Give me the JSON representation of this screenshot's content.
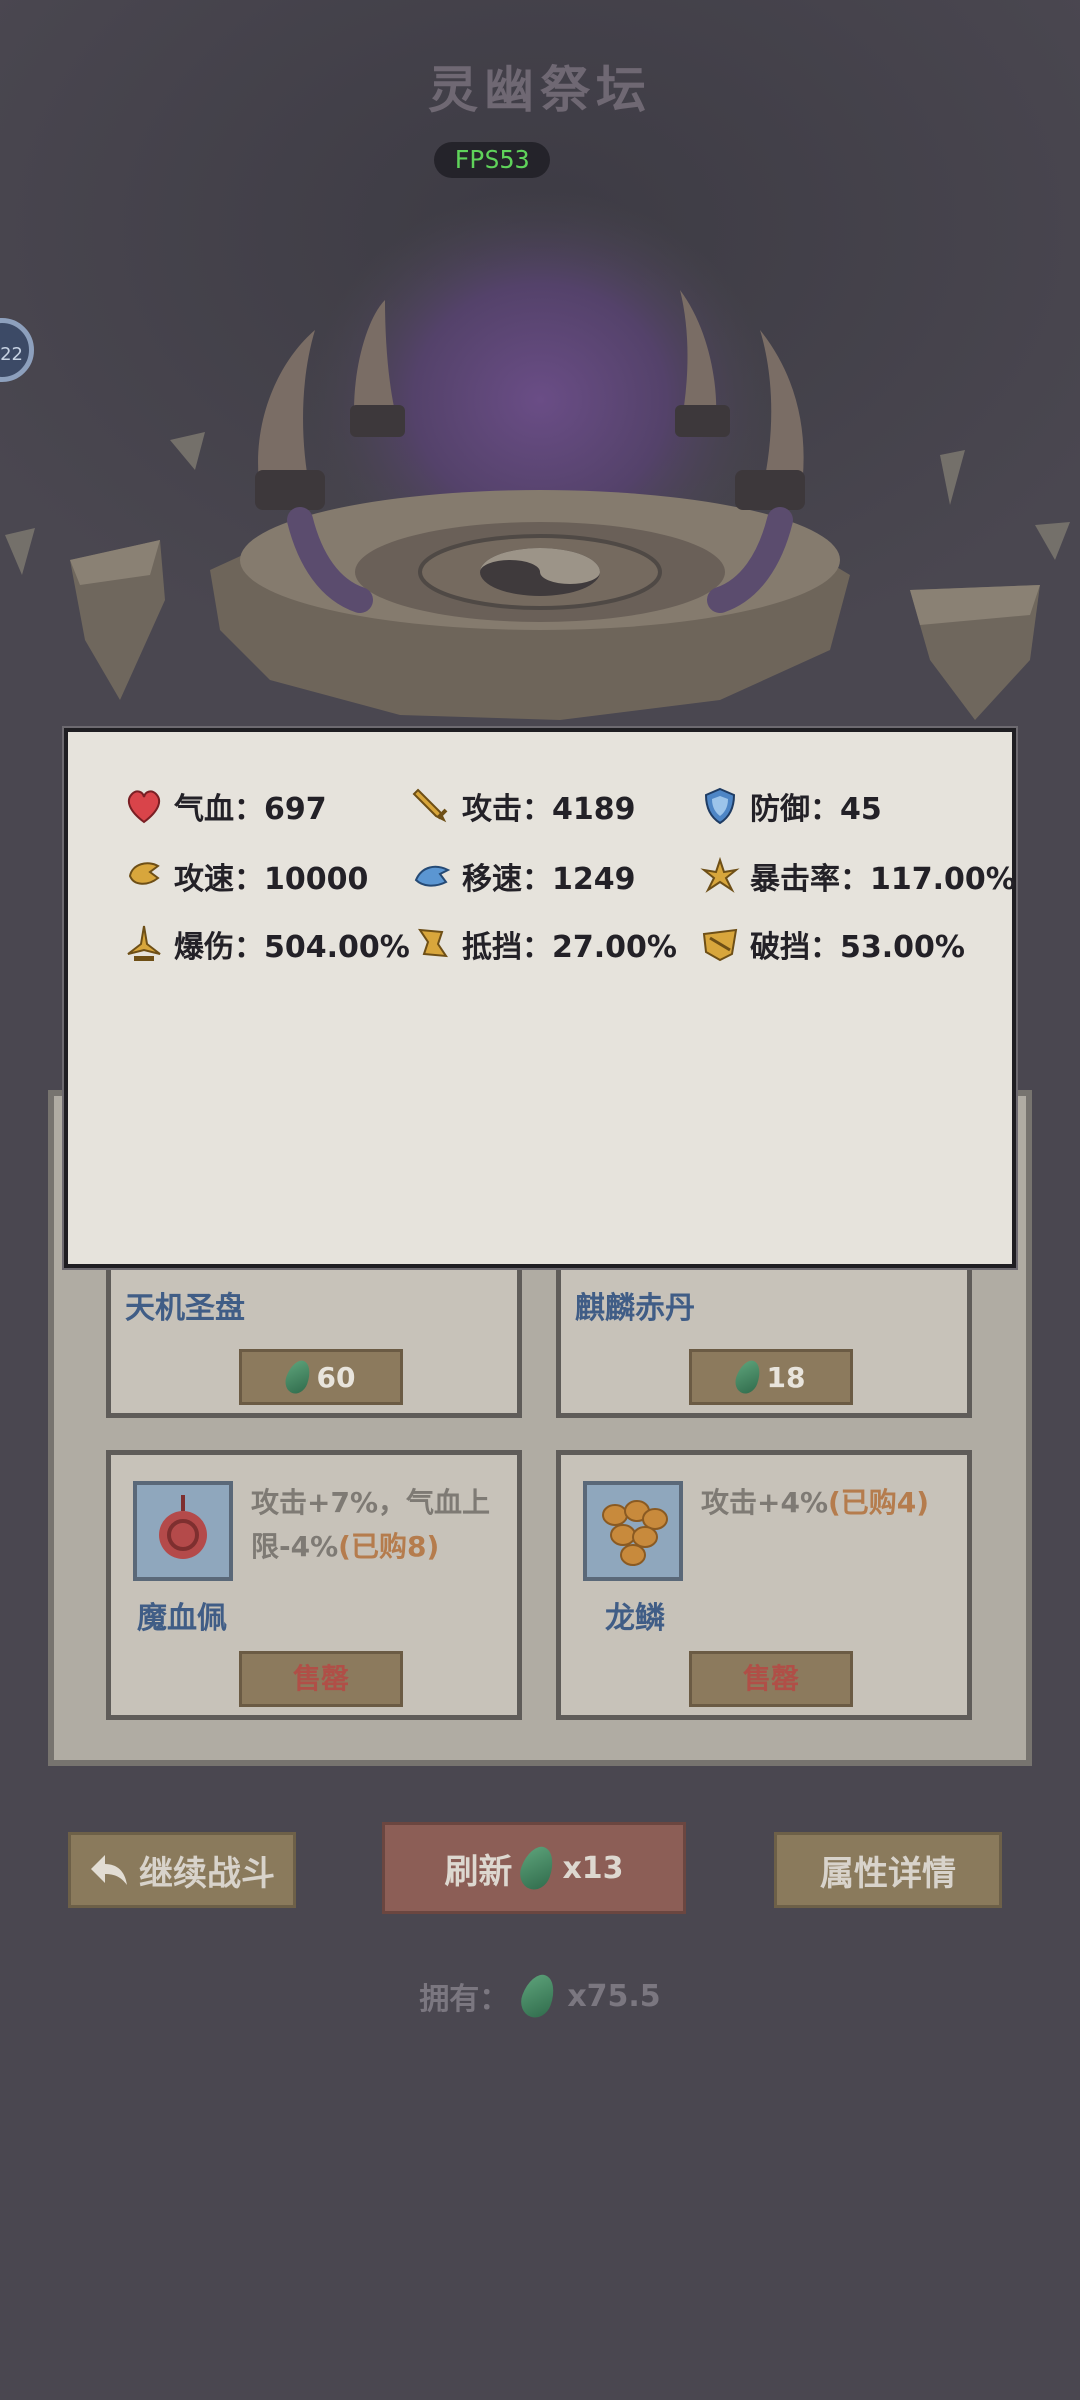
{
  "header": {
    "title": "灵幽祭坛",
    "fps": "FPS53",
    "side_badge": "22"
  },
  "stats": [
    {
      "icon": "heart-icon",
      "label": "气血：697"
    },
    {
      "icon": "sword-icon",
      "label": "攻击：4189"
    },
    {
      "icon": "shield-icon",
      "label": "防御：45"
    },
    {
      "icon": "attack-speed-icon",
      "label": "攻速：10000"
    },
    {
      "icon": "move-speed-icon",
      "label": "移速：1249"
    },
    {
      "icon": "crit-rate-icon",
      "label": "暴击率：117.00%"
    },
    {
      "icon": "crit-damage-icon",
      "label": "爆伤：504.00%"
    },
    {
      "icon": "block-icon",
      "label": "抵挡：27.00%"
    },
    {
      "icon": "break-block-icon",
      "label": "破挡：53.00%"
    }
  ],
  "shop": {
    "cards": [
      {
        "name": "天机圣盘",
        "price": "60"
      },
      {
        "name": "麒麟赤丹",
        "price": "18"
      },
      {
        "name": "魔血佩",
        "desc_line1": "攻击+7%，气血上",
        "desc_line2": "限-4%",
        "bought": "(已购8)",
        "button": "售罄"
      },
      {
        "name": "龙鳞",
        "desc_line1": "攻击+4%",
        "bought": "(已购4)",
        "button": "售罄"
      }
    ]
  },
  "actions": {
    "continue_label": "继续战斗",
    "refresh_label": "刷新",
    "refresh_cost": "x13",
    "details_label": "属性详情"
  },
  "owned": {
    "label": "拥有：",
    "amount": "x75.5"
  },
  "colors": {
    "background": "#4a4750",
    "popup": "#e6e3dc",
    "fps_text": "#5fd35a"
  }
}
